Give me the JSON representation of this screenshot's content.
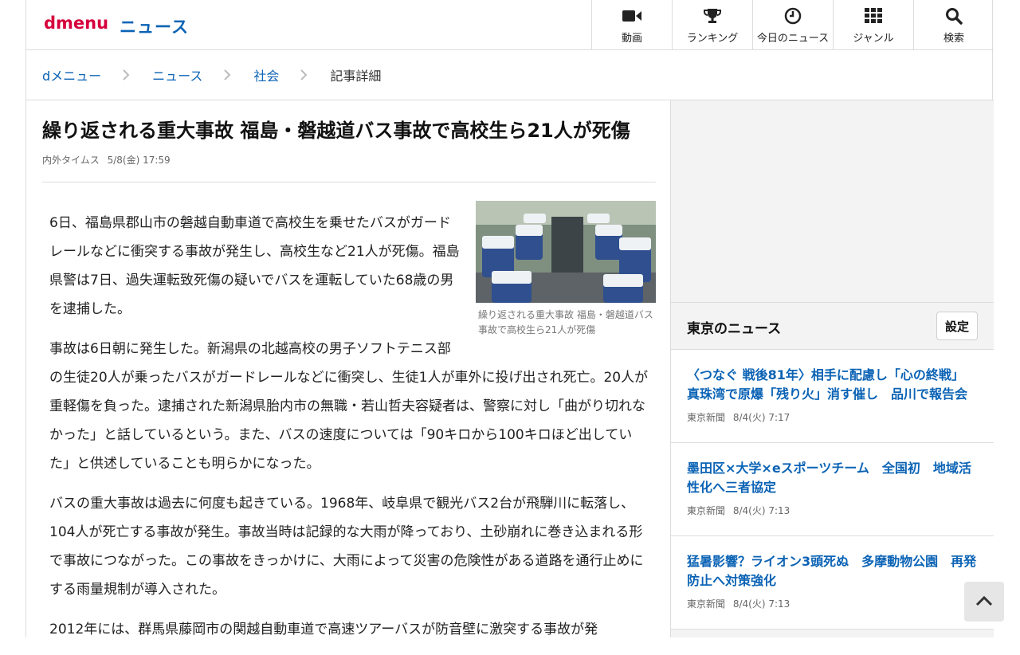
{
  "header": {
    "logo": "dmenu",
    "section": "ニュース",
    "nav": [
      {
        "label": "動画",
        "icon": "video-camera-icon"
      },
      {
        "label": "ランキング",
        "icon": "trophy-icon"
      },
      {
        "label": "今日のニュース",
        "icon": "clock-icon"
      },
      {
        "label": "ジャンル",
        "icon": "grid-icon"
      },
      {
        "label": "検索",
        "icon": "search-icon"
      }
    ]
  },
  "breadcrumb": [
    "dメニュー",
    "ニュース",
    "社会",
    "記事詳細"
  ],
  "article": {
    "title": "繰り返される重大事故 福島・磐越道バス事故で高校生ら21人が死傷",
    "source": "内外タイムス",
    "date": "5/8(金) 17:59",
    "photo_caption": "繰り返される重大事故 福島・磐越道バス事故で高校生ら21人が死傷",
    "paragraphs": [
      "6日、福島県郡山市の磐越自動車道で高校生を乗せたバスがガードレールなどに衝突する事故が発生し、高校生など21人が死傷。福島県警は7日、過失運転致死傷の疑いでバスを運転していた68歳の男を逮捕した。",
      "事故は6日朝に発生した。新潟県の北越高校の男子ソフトテニス部の生徒20人が乗ったバスがガードレールなどに衝突し、生徒1人が車外に投げ出され死亡。20人が重軽傷を負った。逮捕された新潟県胎内市の無職・若山哲夫容疑者は、警察に対し「曲がり切れなかった」と話しているという。また、バスの速度については「90キロから100キロほど出していた」と供述していることも明らかになった。",
      "バスの重大事故は過去に何度も起きている。1968年、岐阜県で観光バス2台が飛騨川に転落し、104人が死亡する事故が発生。事故当時は記録的な大雨が降っており、土砂崩れに巻き込まれる形で事故につながった。この事故をきっかけに、大雨によって災害の危険性がある道路を通行止めにする雨量規制が導入された。",
      "2012年には、群馬県藤岡市の関越自動車道で高速ツアーバスが防音壁に激突する事故が発"
    ]
  },
  "sidebar": {
    "local_title": "東京のニュース",
    "settings_label": "設定",
    "news": [
      {
        "headline": "〈つなぐ 戦後81年〉相手に配慮し「心の終戦」 真珠湾で原爆「残り火」消す催し　品川で報告会",
        "source": "東京新聞",
        "date": "8/4(火) 7:17"
      },
      {
        "headline": "墨田区×大学×eスポーツチーム　全国初　地域活性化へ三者協定",
        "source": "東京新聞",
        "date": "8/4(火) 7:13"
      },
      {
        "headline": "猛暑影響？ライオン3頭死ぬ　多摩動物公園　再発防止へ対策強化",
        "source": "東京新聞",
        "date": "8/4(火) 7:13"
      }
    ]
  },
  "colors": {
    "brand_red": "#d6003c",
    "link_blue": "#0b63b5"
  }
}
